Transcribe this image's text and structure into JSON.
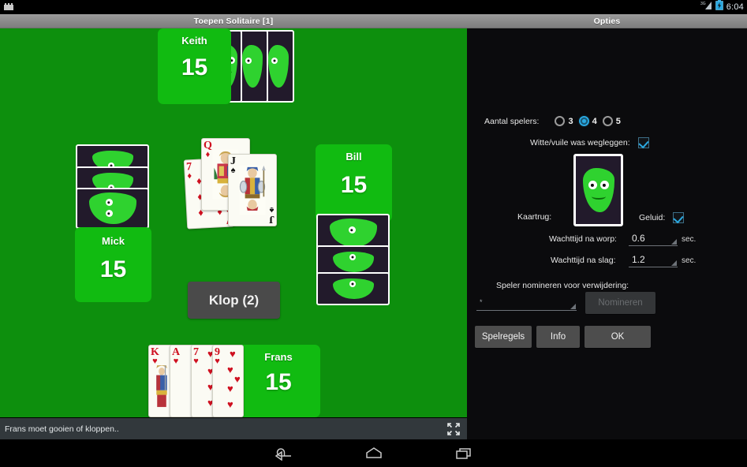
{
  "status_bar": {
    "left_icon": "app-notification-icon",
    "signal_icon": "signal-3g-icon",
    "battery_icon": "battery-charging-icon",
    "clock": "6:04"
  },
  "title_bar": {
    "game_title": "Toepen Solitaire [1]",
    "options_title": "Opties"
  },
  "table": {
    "felt_color": "#0d8f0d",
    "panel_color": "#11bb11",
    "players": [
      {
        "name": "Keith",
        "score": "15",
        "cards_hidden": 3,
        "position": "top"
      },
      {
        "name": "Mick",
        "score": "15",
        "cards_hidden": 3,
        "position": "left"
      },
      {
        "name": "Bill",
        "score": "15",
        "cards_hidden": 3,
        "position": "right"
      },
      {
        "name": "Frans",
        "score": "15",
        "position": "bottom"
      }
    ],
    "hand": [
      {
        "rank": "K",
        "suit": "♥",
        "color": "red"
      },
      {
        "rank": "A",
        "suit": "♥",
        "color": "red"
      },
      {
        "rank": "7",
        "suit": "♥",
        "color": "red"
      },
      {
        "rank": "9",
        "suit": "♥",
        "color": "red"
      }
    ],
    "trick": [
      {
        "rank": "7",
        "suit": "♦",
        "color": "red"
      },
      {
        "rank": "Q",
        "suit": "♦",
        "color": "red"
      },
      {
        "rank": "J",
        "suit": "♠",
        "color": "black"
      }
    ],
    "klop_button": "Klop (2)",
    "status_message": "Frans moet gooien of kloppen.."
  },
  "options": {
    "players_label": "Aantal spelers:",
    "players_choices": [
      "3",
      "4",
      "5"
    ],
    "players_selected": "4",
    "white_dirty_label": "Witte/vuile was wegleggen:",
    "white_dirty_checked": true,
    "cardback_label": "Kaartrug:",
    "sound_label": "Geluid:",
    "sound_checked": true,
    "wait_throw_label": "Wachttijd na worp:",
    "wait_throw_value": "0.6",
    "wait_throw_unit": "sec.",
    "wait_trick_label": "Wachttijd na slag:",
    "wait_trick_value": "1.2",
    "wait_trick_unit": "sec.",
    "nominate_label": "Speler nomineren voor verwijdering:",
    "nominate_spinner_value": "*",
    "nominate_button": "Nomineren",
    "nominate_button_disabled": true,
    "rules_button": "Spelregels",
    "info_button": "Info",
    "ok_button": "OK",
    "accent_color": "#2aa8e0"
  },
  "nav_bar": {
    "back": "back-icon",
    "home": "home-icon",
    "recents": "recents-icon"
  }
}
